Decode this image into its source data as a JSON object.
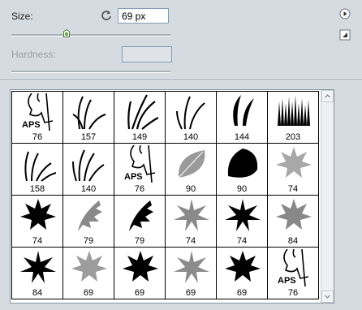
{
  "size": {
    "label": "Size:",
    "value": "69 px",
    "slider_fraction": 0.34
  },
  "hardness": {
    "label": "Hardness:",
    "value": ""
  },
  "brushes": [
    {
      "value": "76",
      "icon": "face-sketch-icon"
    },
    {
      "value": "157",
      "icon": "grass-icon"
    },
    {
      "value": "149",
      "icon": "grass-icon"
    },
    {
      "value": "140",
      "icon": "grass-icon"
    },
    {
      "value": "144",
      "icon": "grass-icon"
    },
    {
      "value": "203",
      "icon": "dune-grass-icon"
    },
    {
      "value": "158",
      "icon": "grass-icon"
    },
    {
      "value": "140",
      "icon": "grass-icon"
    },
    {
      "value": "76",
      "icon": "face-sketch-icon"
    },
    {
      "value": "90",
      "icon": "leaf-icon"
    },
    {
      "value": "90",
      "icon": "leaf-icon"
    },
    {
      "value": "74",
      "icon": "maple-leaf-icon"
    },
    {
      "value": "74",
      "icon": "maple-leaf-icon"
    },
    {
      "value": "79",
      "icon": "oak-leaf-icon"
    },
    {
      "value": "79",
      "icon": "oak-leaf-icon"
    },
    {
      "value": "74",
      "icon": "maple-leaf-icon"
    },
    {
      "value": "74",
      "icon": "maple-leaf-icon"
    },
    {
      "value": "84",
      "icon": "maple-leaf-icon"
    },
    {
      "value": "84",
      "icon": "maple-leaf-icon"
    },
    {
      "value": "69",
      "icon": "maple-leaf-icon"
    },
    {
      "value": "69",
      "icon": "maple-leaf-icon"
    },
    {
      "value": "69",
      "icon": "maple-leaf-icon"
    },
    {
      "value": "69",
      "icon": "maple-leaf-icon"
    },
    {
      "value": "76",
      "icon": "face-sketch-icon"
    }
  ],
  "face_sketch_text": "APS"
}
